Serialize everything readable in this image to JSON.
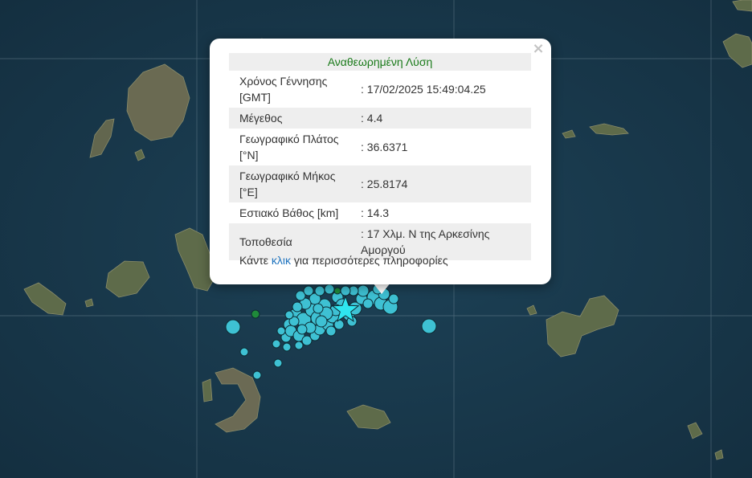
{
  "popup": {
    "title": "Αναθεωρημένη Λύση",
    "rows": [
      {
        "label": "Χρόνος Γέννησης [GMT]",
        "value": ": 17/02/2025 15:49:04.25"
      },
      {
        "label": "Μέγεθος",
        "value": ": 4.4"
      },
      {
        "label": "Γεωγραφικό Πλάτος [°N]",
        "value": ": 36.6371"
      },
      {
        "label": "Γεωγραφικό Μήκος [°E]",
        "value": ": 25.8174"
      },
      {
        "label": "Εστιακό Βάθος [km]",
        "value": ": 14.3"
      },
      {
        "label": "Τοποθεσία",
        "value": ": 17 Χλμ. Ν της Αρκεσίνης Αμοργού"
      }
    ],
    "more_prefix": "Κάντε ",
    "more_link": "κλικ",
    "more_suffix": " για περισσότερες πληροφορίες",
    "close_icon": "close-icon"
  },
  "map": {
    "marker_color": "#3ec1d3",
    "recent_marker_color": "#1f8a3a",
    "star_color": "#2fe6f0",
    "sea_color": "#1a3a4e"
  }
}
